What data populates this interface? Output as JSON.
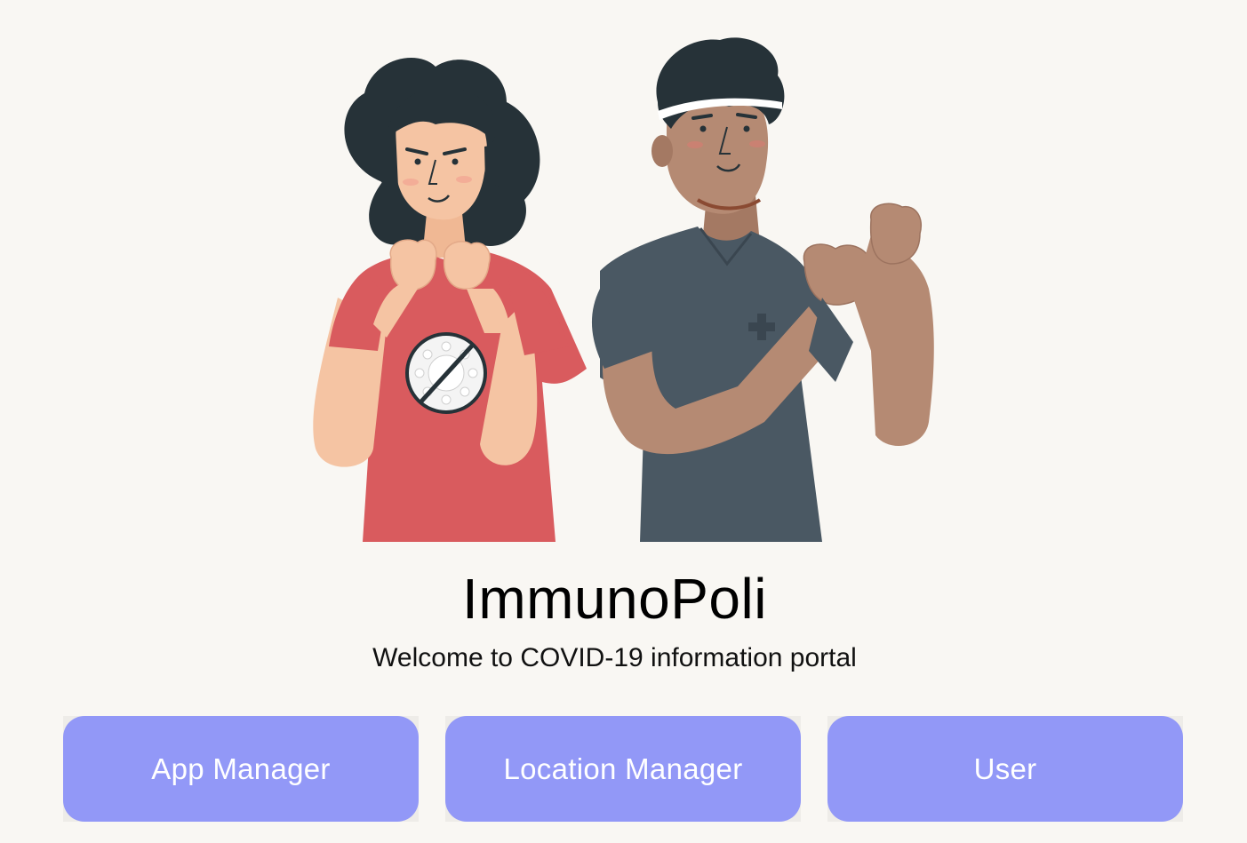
{
  "app": {
    "title": "ImmunoPoli",
    "subtitle": "Welcome to COVID-19 information portal"
  },
  "hero": {
    "icon": "two-people-fist-pump-illustration",
    "badge_icon": "no-virus-icon"
  },
  "buttons": [
    {
      "label": "App Manager"
    },
    {
      "label": "Location Manager"
    },
    {
      "label": "User"
    }
  ],
  "colors": {
    "background": "#f9f7f3",
    "button": "#9298f7",
    "button_text": "#ffffff",
    "woman_shirt": "#d95b5e",
    "man_shirt": "#4a5863",
    "woman_skin": "#f5c4a3",
    "man_skin": "#b58a73",
    "hair": "#263238"
  }
}
